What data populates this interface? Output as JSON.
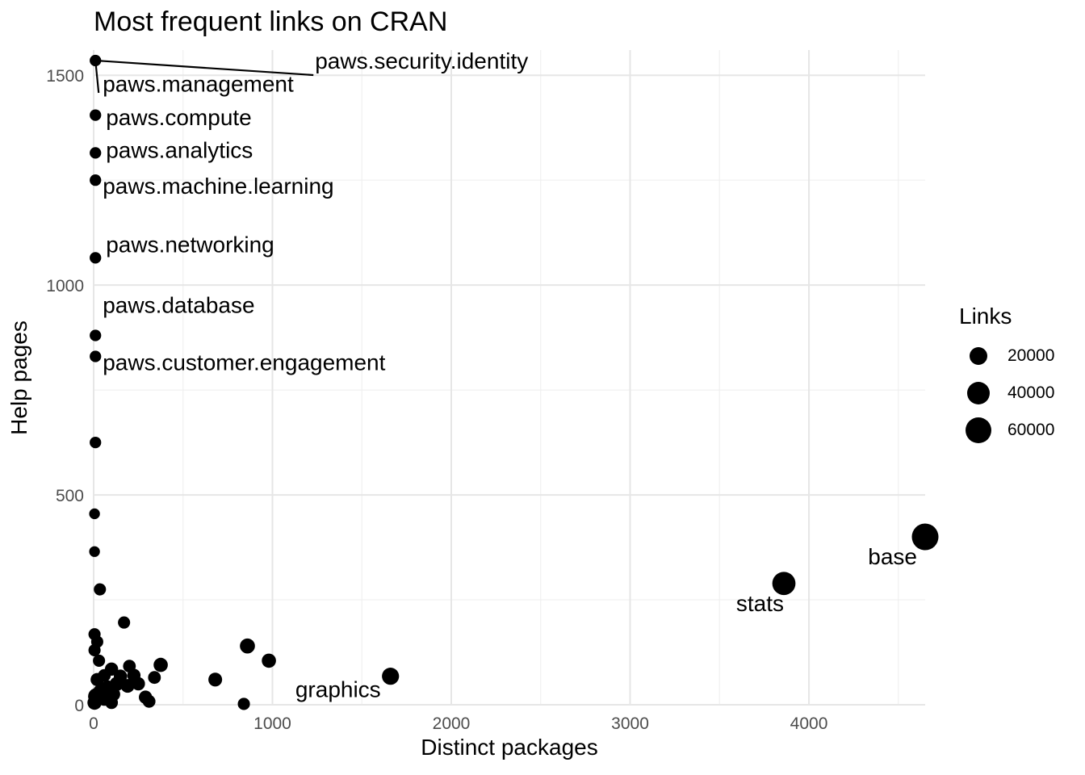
{
  "chart_data": {
    "type": "scatter",
    "title": "Most frequent links on CRAN",
    "xlabel": "Distinct packages",
    "ylabel": "Help pages",
    "xlim": [
      0,
      4650
    ],
    "ylim": [
      0,
      1560
    ],
    "x_ticks": [
      0,
      1000,
      2000,
      3000,
      4000
    ],
    "y_ticks": [
      0,
      500,
      1000,
      1500
    ],
    "grid": true,
    "legend": {
      "title": "Links",
      "position": "right",
      "entries": [
        {
          "label": "20000",
          "value": 20000
        },
        {
          "label": "40000",
          "value": 40000
        },
        {
          "label": "60000",
          "value": 60000
        }
      ]
    },
    "points": [
      {
        "x": 4650,
        "y": 400,
        "links": 62000,
        "label": "base"
      },
      {
        "x": 3860,
        "y": 289,
        "links": 42000,
        "label": "stats"
      },
      {
        "x": 1660,
        "y": 68,
        "links": 16000,
        "label": "graphics"
      },
      {
        "x": 10,
        "y": 1535,
        "links": 3000,
        "label": "paws.security.identity"
      },
      {
        "x": 10,
        "y": 1405,
        "links": 3000,
        "label": "paws.management"
      },
      {
        "x": 10,
        "y": 1315,
        "links": 3000,
        "label": "paws.compute"
      },
      {
        "x": 10,
        "y": 1250,
        "links": 3000,
        "label": "paws.analytics"
      },
      {
        "x": 10,
        "y": 1065,
        "links": 3000,
        "label": "paws.machine.learning"
      },
      {
        "x": 10,
        "y": 880,
        "links": 3000,
        "label": "paws.networking"
      },
      {
        "x": 10,
        "y": 830,
        "links": 3000,
        "label": "paws.database"
      },
      {
        "x": 10,
        "y": 625,
        "links": 3000,
        "label": "paws.customer.engagement"
      },
      {
        "x": 5,
        "y": 455,
        "links": 2000,
        "label": ""
      },
      {
        "x": 5,
        "y": 365,
        "links": 2000,
        "label": ""
      },
      {
        "x": 35,
        "y": 275,
        "links": 4000,
        "label": ""
      },
      {
        "x": 170,
        "y": 196,
        "links": 4000,
        "label": ""
      },
      {
        "x": 5,
        "y": 168,
        "links": 4000,
        "label": ""
      },
      {
        "x": 20,
        "y": 150,
        "links": 4000,
        "label": ""
      },
      {
        "x": 5,
        "y": 130,
        "links": 4000,
        "label": ""
      },
      {
        "x": 30,
        "y": 105,
        "links": 4000,
        "label": ""
      },
      {
        "x": 860,
        "y": 140,
        "links": 10000,
        "label": ""
      },
      {
        "x": 980,
        "y": 105,
        "links": 8000,
        "label": ""
      },
      {
        "x": 375,
        "y": 95,
        "links": 8000,
        "label": ""
      },
      {
        "x": 680,
        "y": 60,
        "links": 7000,
        "label": ""
      },
      {
        "x": 200,
        "y": 92,
        "links": 5000,
        "label": ""
      },
      {
        "x": 340,
        "y": 65,
        "links": 5000,
        "label": ""
      },
      {
        "x": 225,
        "y": 70,
        "links": 6000,
        "label": ""
      },
      {
        "x": 150,
        "y": 68,
        "links": 6000,
        "label": ""
      },
      {
        "x": 100,
        "y": 85,
        "links": 6000,
        "label": ""
      },
      {
        "x": 60,
        "y": 70,
        "links": 5000,
        "label": ""
      },
      {
        "x": 20,
        "y": 60,
        "links": 6000,
        "label": ""
      },
      {
        "x": 250,
        "y": 50,
        "links": 6000,
        "label": ""
      },
      {
        "x": 190,
        "y": 45,
        "links": 7000,
        "label": ""
      },
      {
        "x": 130,
        "y": 50,
        "links": 8000,
        "label": ""
      },
      {
        "x": 80,
        "y": 40,
        "links": 10000,
        "label": ""
      },
      {
        "x": 40,
        "y": 30,
        "links": 12000,
        "label": ""
      },
      {
        "x": 15,
        "y": 20,
        "links": 14000,
        "label": ""
      },
      {
        "x": 60,
        "y": 15,
        "links": 9000,
        "label": ""
      },
      {
        "x": 110,
        "y": 25,
        "links": 7000,
        "label": ""
      },
      {
        "x": 290,
        "y": 18,
        "links": 6000,
        "label": ""
      },
      {
        "x": 310,
        "y": 8,
        "links": 5000,
        "label": ""
      },
      {
        "x": 840,
        "y": 2,
        "links": 4000,
        "label": ""
      },
      {
        "x": 5,
        "y": 5,
        "links": 8000,
        "label": ""
      },
      {
        "x": 100,
        "y": 5,
        "links": 5000,
        "label": ""
      }
    ]
  }
}
